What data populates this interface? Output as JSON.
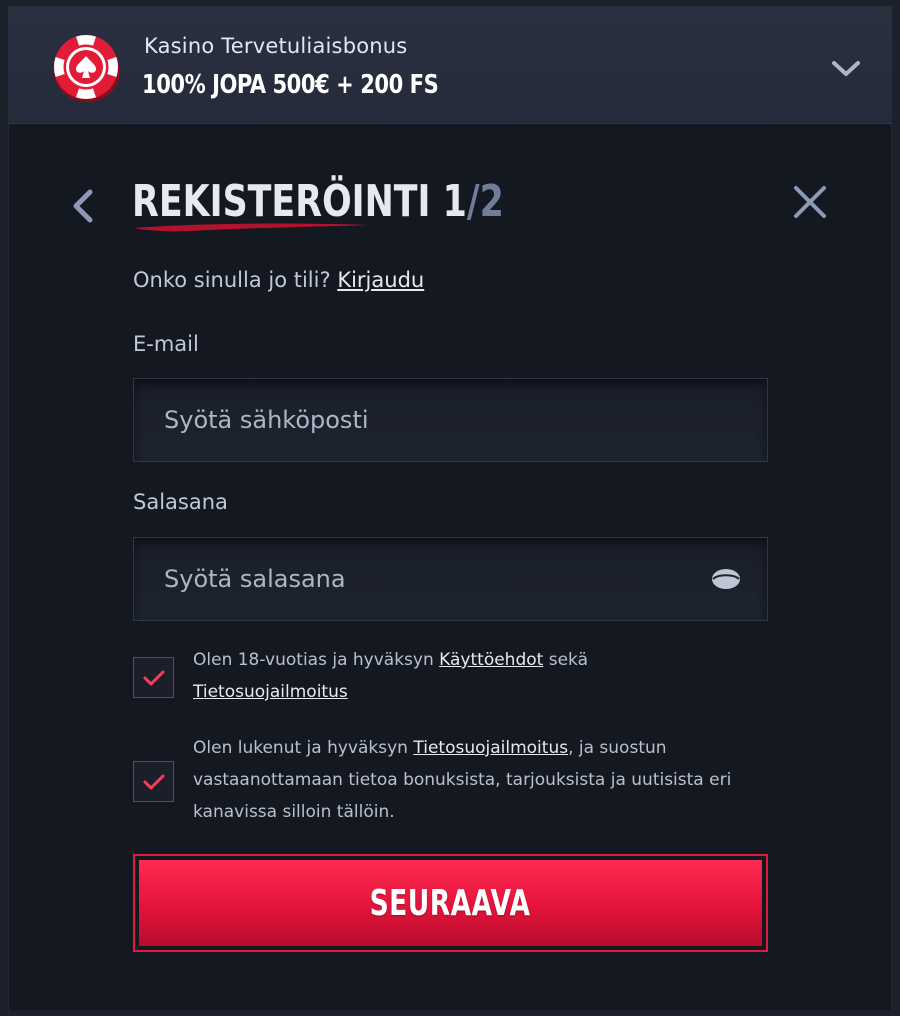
{
  "bonus": {
    "subtitle": "Kasino Tervetuliaisbonus",
    "title": "100% JOPA 500€ + 200 FS",
    "icon": "casino-chip-icon"
  },
  "header": {
    "title_main": "REKISTERÖINTI",
    "step_current": "1",
    "step_separator": "/",
    "step_total": "2"
  },
  "login_prompt": {
    "text": "Onko sinulla jo tili?",
    "link": "Kirjaudu"
  },
  "email": {
    "label": "E-mail",
    "placeholder": "Syötä sähköposti",
    "value": ""
  },
  "password": {
    "label": "Salasana",
    "placeholder": "Syötä salasana",
    "value": ""
  },
  "consent1": {
    "checked": true,
    "text_a": "Olen 18-vuotias ja hyväksyn",
    "link_a": "Käyttöehdot",
    "text_b": "sekä",
    "link_b": "Tietosuojailmoitus"
  },
  "consent2": {
    "checked": true,
    "text_a": "Olen lukenut ja hyväksyn",
    "link_a": "Tietosuojailmoitus",
    "text_b": ", ja suostun vastaanottamaan tietoa bonuksista, tarjouksista ja uutisista eri kanavissa silloin tällöin."
  },
  "next_button": {
    "label": "SEURAAVA"
  },
  "colors": {
    "accent": "#e3143b",
    "background": "#141821",
    "check": "#ff3b5c"
  }
}
